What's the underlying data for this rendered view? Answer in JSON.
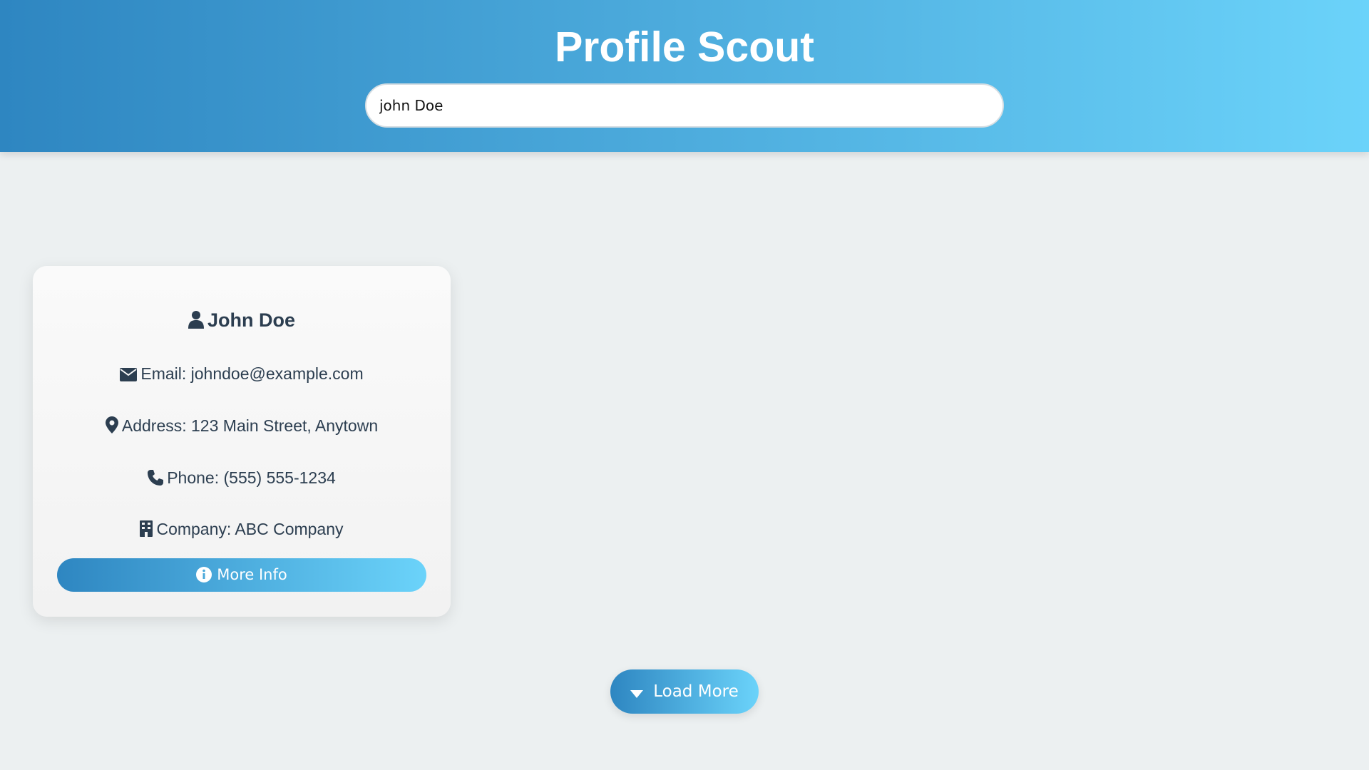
{
  "header": {
    "title": "Profile Scout",
    "search_value": "john Doe"
  },
  "profile_card": {
    "name": "John Doe",
    "name_icon": "user-icon",
    "fields": [
      {
        "icon": "envelope-icon",
        "text": "Email: johndoe@example.com"
      },
      {
        "icon": "map-marker-icon",
        "text": "Address: 123 Main Street, Anytown"
      },
      {
        "icon": "phone-icon",
        "text": "Phone: (555) 555-1234"
      },
      {
        "icon": "building-icon",
        "text": "Company: ABC Company"
      }
    ],
    "more_info_label": "More Info",
    "more_info_icon": "info-circle-icon"
  },
  "load_more": {
    "label": "Load More",
    "icon": "caret-down-icon"
  },
  "colors": {
    "gradient_start": "#2e86c1",
    "gradient_end": "#6bd3fa",
    "page_background": "#ecf0f1",
    "text_dark": "#2c3e50"
  }
}
